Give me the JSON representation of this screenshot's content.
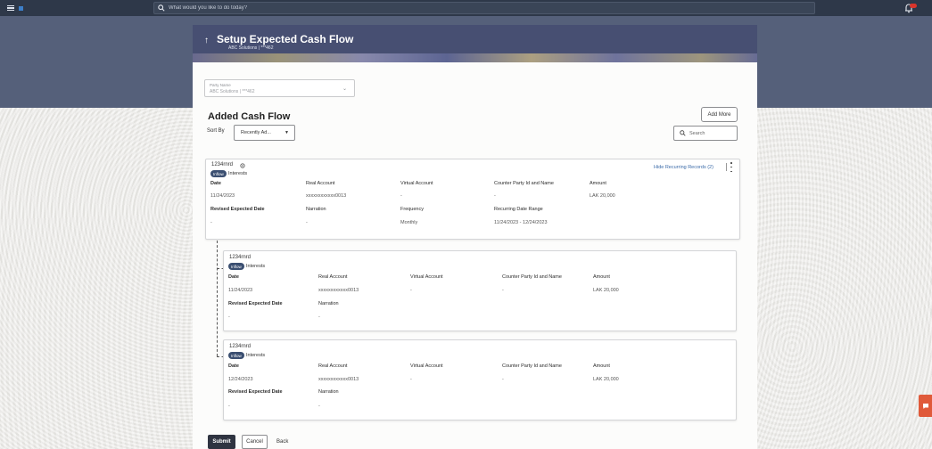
{
  "topbar": {
    "search_placeholder": "What would you like to do today?"
  },
  "header": {
    "title": "Setup Expected Cash Flow",
    "subtitle": "ABC Solutions | ***462"
  },
  "party": {
    "label": "Party Name",
    "value": "ABC Solutions | ***462"
  },
  "section_title": "Added Cash Flow",
  "add_more_label": "Add More",
  "sort": {
    "label": "Sort By",
    "value": "Recently Ad..."
  },
  "list_search_placeholder": "Search",
  "main_record": {
    "id": "1234rnrd",
    "type_badge": "Inflow",
    "category": "Interests",
    "hide_recurring_label": "Hide Recurring Records (2)",
    "labels": {
      "date": "Date",
      "real_account": "Real Account",
      "virtual_account": "Virtual Account",
      "counter_party": "Counter Party Id and Name",
      "amount": "Amount",
      "revised_date": "Revised Expected Date",
      "narration": "Narration",
      "frequency": "Frequency",
      "recurring_range": "Recurring Date Range"
    },
    "values": {
      "date": "11/24/2023",
      "real_account": "xxxxxxxxxxxx0013",
      "virtual_account": "-",
      "counter_party": "-",
      "amount": "LAK 20,000",
      "revised_date": "-",
      "narration": "-",
      "frequency": "Monthly",
      "recurring_range": "11/24/2023 - 12/24/2023"
    }
  },
  "sub_records": [
    {
      "id": "1234rnrd",
      "type_badge": "Inflow",
      "category": "Interests",
      "labels": {
        "date": "Date",
        "real_account": "Real Account",
        "virtual_account": "Virtual Account",
        "counter_party": "Counter Party Id and Name",
        "amount": "Amount",
        "revised_date": "Revised Expected Date",
        "narration": "Narration"
      },
      "values": {
        "date": "11/24/2023",
        "real_account": "xxxxxxxxxxxx0013",
        "virtual_account": "-",
        "counter_party": "-",
        "amount": "LAK 20,000",
        "revised_date": "-",
        "narration": "-"
      }
    },
    {
      "id": "1234rnrd",
      "type_badge": "Inflow",
      "category": "Interests",
      "labels": {
        "date": "Date",
        "real_account": "Real Account",
        "virtual_account": "Virtual Account",
        "counter_party": "Counter Party Id and Name",
        "amount": "Amount",
        "revised_date": "Revised Expected Date",
        "narration": "Narration"
      },
      "values": {
        "date": "12/24/2023",
        "real_account": "xxxxxxxxxxxx0013",
        "virtual_account": "-",
        "counter_party": "-",
        "amount": "LAK 20,000",
        "revised_date": "-",
        "narration": "-"
      }
    }
  ],
  "actions": {
    "submit": "Submit",
    "cancel": "Cancel",
    "back": "Back"
  },
  "colors": {
    "topbar": "#2e3849",
    "hero": "#55607a",
    "badge": "#3b4f71",
    "link": "#3a6aa8",
    "chat": "#e05a3a",
    "notification": "#d9342b"
  }
}
